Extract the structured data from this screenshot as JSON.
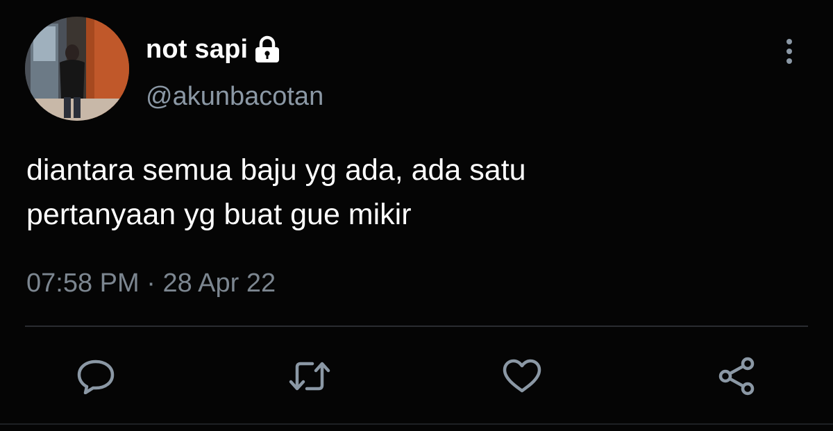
{
  "tweet": {
    "display_name": "not sapi",
    "handle": "@akunbacotan",
    "text_line_1": "diantara semua baju yg ada, ada satu",
    "text_line_2": "pertanyaan yg buat gue mikir",
    "time": "07:58 PM",
    "separator": " · ",
    "date": "28 Apr 22"
  },
  "icons": {
    "lock": "lock-icon",
    "more": "more-vertical-icon",
    "reply": "reply-icon",
    "retweet": "retweet-icon",
    "like": "heart-icon",
    "share": "share-icon"
  },
  "colors": {
    "background": "#050505",
    "text_primary": "#ffffff",
    "text_secondary": "#8b98a5",
    "icon": "#8b98a5",
    "divider": "#2a2d31"
  }
}
